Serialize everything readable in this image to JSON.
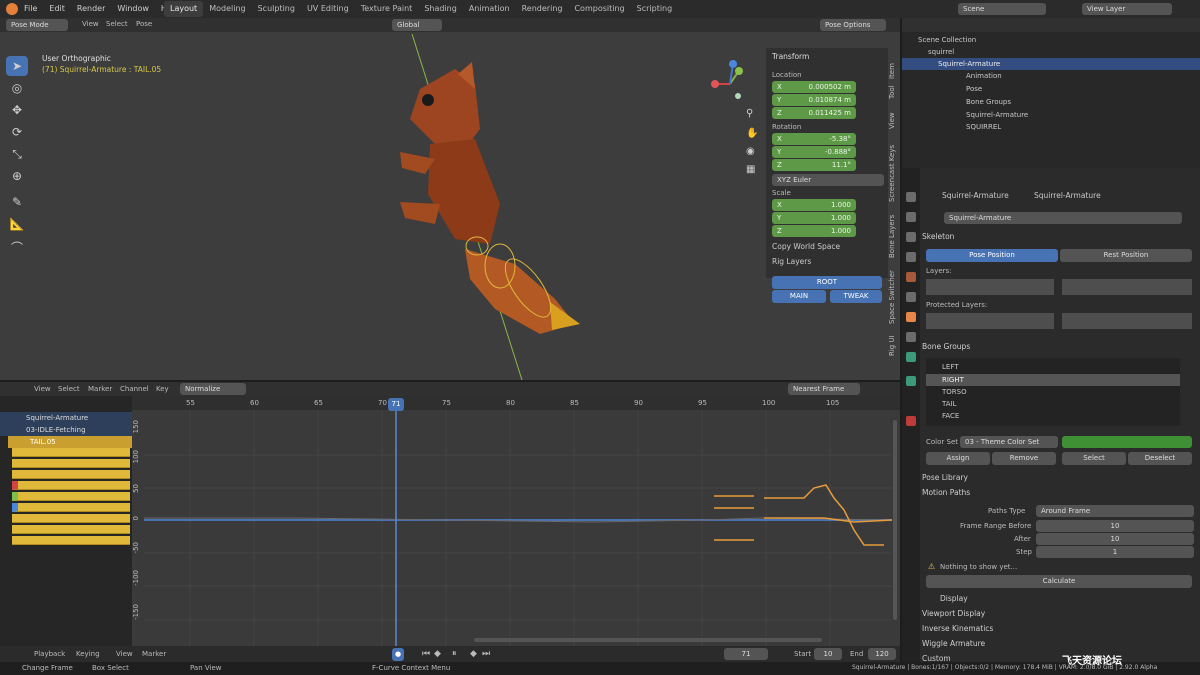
{
  "topbar": {
    "menus": [
      "File",
      "Edit",
      "Render",
      "Window",
      "Help"
    ],
    "workspaces": [
      "Layout",
      "Modeling",
      "Sculpting",
      "UV Editing",
      "Texture Paint",
      "Shading",
      "Animation",
      "Rendering",
      "Compositing",
      "Scripting"
    ],
    "scene": "Scene",
    "view_layer": "View Layer"
  },
  "viewport": {
    "mode": "Pose Mode",
    "menus": [
      "View",
      "Select",
      "Pose"
    ],
    "transform_orient": "Global",
    "pose_options": "Pose Options",
    "title": "User Orthographic",
    "subtitle": "(71) Squirrel-Armature : TAIL.05"
  },
  "npanel": {
    "transform_header": "Transform",
    "location_label": "Location",
    "loc": [
      {
        "a": "X",
        "v": "0.000502 m"
      },
      {
        "a": "Y",
        "v": "0.010874 m"
      },
      {
        "a": "Z",
        "v": "0.011425 m"
      }
    ],
    "rotation_label": "Rotation",
    "rot": [
      {
        "a": "X",
        "v": "-5.38°"
      },
      {
        "a": "Y",
        "v": "-0.888°"
      },
      {
        "a": "Z",
        "v": "11.1°"
      }
    ],
    "euler": "XYZ Euler",
    "scale_label": "Scale",
    "scl": [
      {
        "a": "X",
        "v": "1.000"
      },
      {
        "a": "Y",
        "v": "1.000"
      },
      {
        "a": "Z",
        "v": "1.000"
      }
    ],
    "copy_world": "Copy World Space",
    "rig_layers": "Rig Layers",
    "rig_btns": [
      "ROOT",
      "MAIN",
      "TWEAK"
    ],
    "tabs": [
      "Item",
      "Tool",
      "View",
      "Screencast Keys",
      "Bone Layers",
      "Space Switcher",
      "Rig UI"
    ]
  },
  "outliner": {
    "root": "Scene Collection",
    "items": [
      "squirrel",
      "Squirrel-Armature",
      "Animation",
      "Pose",
      "Bone Groups",
      "Squirrel-Armature",
      "SQUIRREL"
    ]
  },
  "properties": {
    "obj1": "Squirrel-Armature",
    "obj2": "Squirrel-Armature",
    "data_name": "Squirrel-Armature",
    "skeleton": "Skeleton",
    "pose_position": "Pose Position",
    "rest_position": "Rest Position",
    "layers": "Layers:",
    "protected_layers": "Protected Layers:",
    "bone_groups": "Bone Groups",
    "groups": [
      "LEFT",
      "RIGHT",
      "TORSO",
      "TAIL",
      "FACE"
    ],
    "color_set": "Color Set",
    "color_set_value": "03 - Theme Color Set",
    "assign": "Assign",
    "remove": "Remove",
    "select": "Select",
    "deselect": "Deselect",
    "pose_library": "Pose Library",
    "motion_paths": "Motion Paths",
    "paths_type_label": "Paths Type",
    "paths_type": "Around Frame",
    "frame_before_label": "Frame Range Before",
    "frame_before": "10",
    "after_label": "After",
    "after": "10",
    "step_label": "Step",
    "step": "1",
    "nothing": "Nothing to show yet...",
    "calculate": "Calculate",
    "display": "Display",
    "viewport_display": "Viewport Display",
    "ik": "Inverse Kinematics",
    "wiggle": "Wiggle Armature",
    "custom": "Custom"
  },
  "graph": {
    "menus": [
      "View",
      "Select",
      "Marker",
      "Channel",
      "Key"
    ],
    "normalize": "Normalize",
    "pivot": "Nearest Frame",
    "frames": [
      "55",
      "60",
      "65",
      "70",
      "75",
      "80",
      "85",
      "90",
      "95",
      "100",
      "105"
    ],
    "current_frame": "71",
    "y_labels": [
      "150",
      "100",
      "50",
      "0",
      "-50",
      "-100",
      "-150"
    ],
    "channels": {
      "object": "Squirrel-Armature",
      "action": "03-IDLE-Fetching",
      "group": "TAIL.05"
    }
  },
  "timeline": {
    "menus": [
      "Playback",
      "Keying",
      "View",
      "Marker"
    ],
    "frame": "71",
    "start_label": "Start",
    "start": "10",
    "end_label": "End",
    "end": "120"
  },
  "status": {
    "items": [
      "Change Frame",
      "Box Select",
      "Pan View",
      "F-Curve Context Menu"
    ],
    "info": "Squirrel-Armature | Bones:1/167 | Objects:0/2 | Memory: 178.4 MiB | VRAM: 2.0/8.0 GiB | 2.92.0 Alpha"
  },
  "watermark": "飞天资源论坛"
}
